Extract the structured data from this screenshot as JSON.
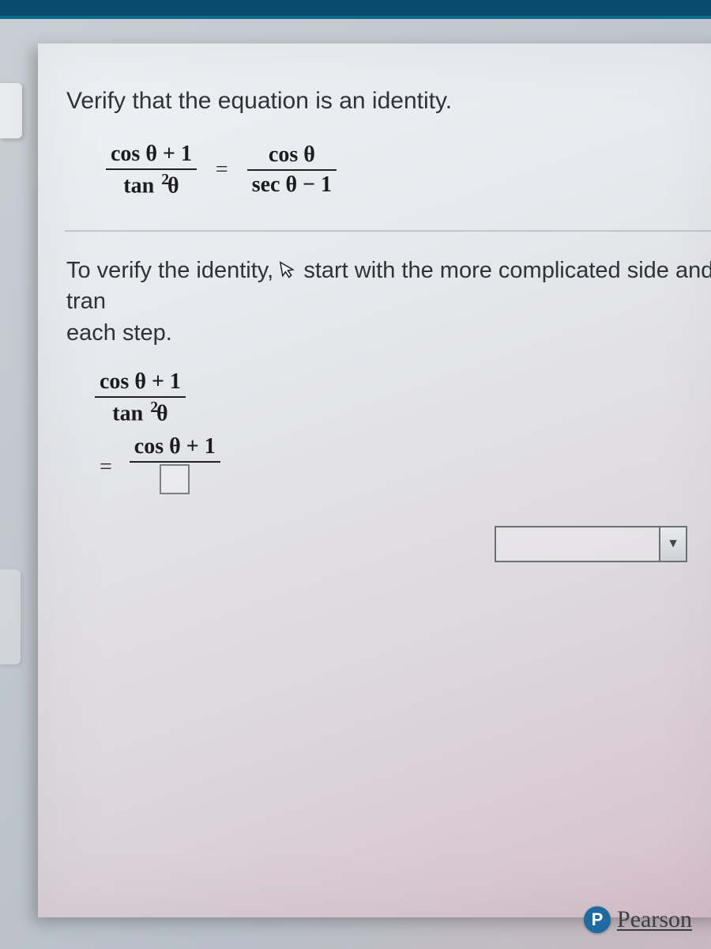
{
  "prompt": "Verify that the equation is an identity.",
  "equation": {
    "left_num": "cos θ + 1",
    "left_den_base": "tan ",
    "left_den_exp": "2",
    "left_den_arg": "θ",
    "equals": "=",
    "right_num": "cos θ",
    "right_den": "sec θ − 1"
  },
  "instruction_pre": "To verify the identity,",
  "instruction_post": "start with the more complicated side and tran",
  "instruction_line2": "each step.",
  "work": {
    "lhs_num": "cos θ + 1",
    "lhs_den_base": "tan ",
    "lhs_den_exp": "2",
    "lhs_den_arg": "θ",
    "step_equals": "=",
    "step_num": "cos θ + 1"
  },
  "dropdown_arrow": "▼",
  "brand_initial": "P",
  "brand_name": "Pearson"
}
